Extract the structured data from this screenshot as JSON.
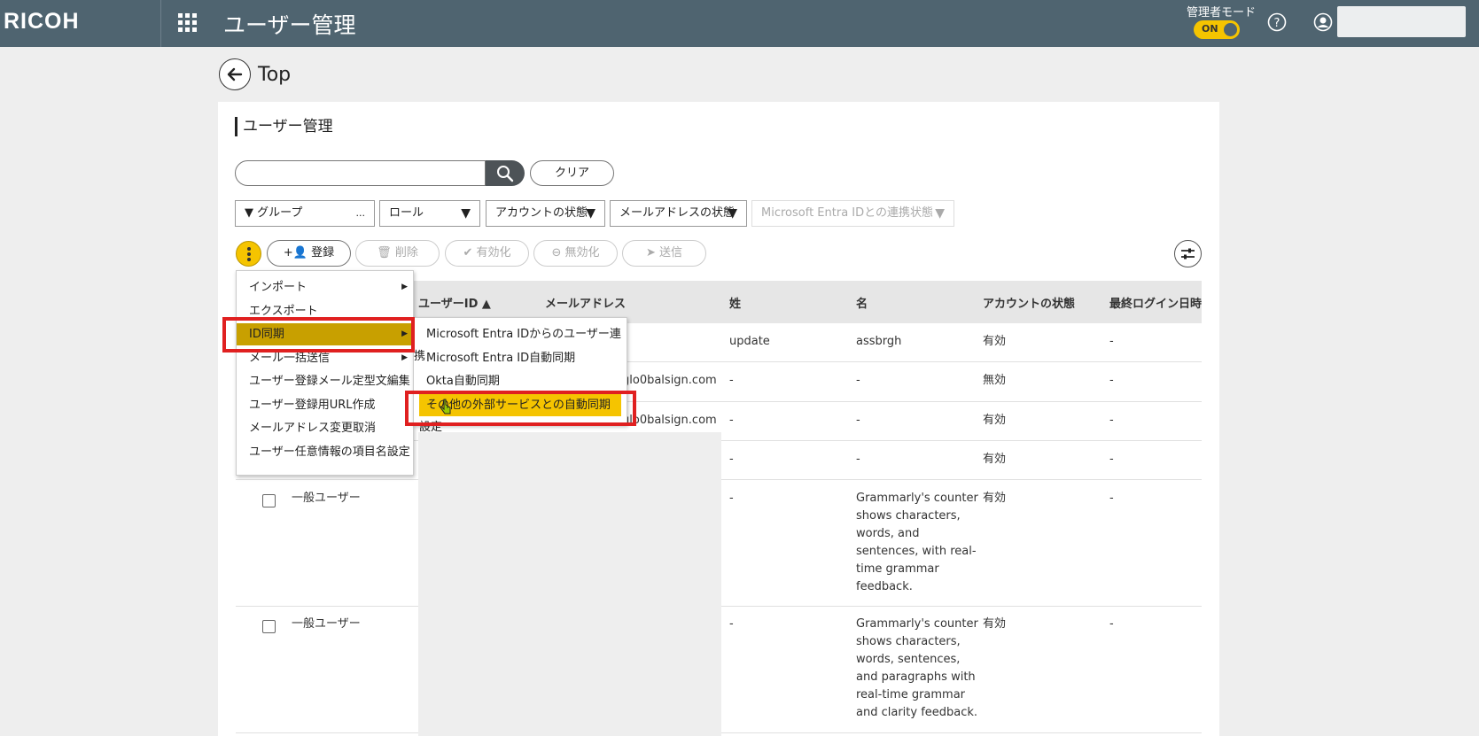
{
  "header": {
    "logo": "RICOH",
    "title": "ユーザー管理",
    "admin_mode_label": "管理者モード",
    "admin_mode_toggle": "ON"
  },
  "nav": {
    "back_label": "Top"
  },
  "page": {
    "title": "ユーザー管理",
    "search_placeholder": "",
    "clear_label": "クリア"
  },
  "filters": {
    "group": "グループ",
    "group_more": "...",
    "role": "ロール",
    "account_state": "アカウントの状態",
    "email_state": "メールアドレスの状態",
    "entra_link_state": "Microsoft Entra IDとの連携状態"
  },
  "actions": {
    "register": "登録",
    "delete": "削除",
    "enable": "有効化",
    "disable": "無効化",
    "send": "送信"
  },
  "table": {
    "headers": {
      "user_id": "ユーザーID ▲",
      "email": "メールアドレス",
      "last_name": "姓",
      "first_name": "名",
      "account_state": "アカウントの状態",
      "last_login": "最終ログイン日時"
    },
    "rows": [
      {
        "last_name": "update",
        "first_name": "assbrgh",
        "state": "有効",
        "last_login": "-"
      },
      {
        "email_tail": "glo0balsign.com",
        "last_name": "-",
        "first_name": "-",
        "state": "無効",
        "last_login": "-"
      },
      {
        "email_tail": "glo0balsign.com",
        "last_name": "-",
        "first_name": "-",
        "state": "有効",
        "last_login": "-"
      },
      {
        "last_name": "-",
        "first_name": "-",
        "state": "有効",
        "last_login": "-"
      },
      {
        "role": "一般ユーザー",
        "last_name": "-",
        "first_name_lines": [
          "Grammarly's counter",
          "shows characters,",
          "words, and",
          "sentences, with real-",
          "time grammar",
          "feedback."
        ],
        "state": "有効",
        "last_login": "-"
      },
      {
        "role": "一般ユーザー",
        "last_name": "-",
        "first_name_lines": [
          "Grammarly's counter",
          "shows characters,",
          "words, sentences,",
          "and paragraphs with",
          "real-time grammar",
          "and clarity feedback."
        ],
        "state": "有効",
        "last_login": "-"
      }
    ]
  },
  "menu": {
    "items": [
      "インポート",
      "エクスポート",
      "ID同期",
      "メール一括送信",
      "ユーザー登録メール定型文編集",
      "ユーザー登録用URL作成",
      "メールアドレス変更取消",
      "ユーザー任意情報の項目名設定"
    ],
    "active": "ID同期"
  },
  "submenu": {
    "items": [
      "Microsoft Entra IDからのユーザー連携",
      "Microsoft Entra ID自動同期",
      "Okta自動同期",
      "その他の外部サービスとの自動同期設定"
    ],
    "active": "その他の外部サービスとの自動同期設定"
  },
  "colors": {
    "header_bg": "#4f6470",
    "accent": "#f5c400",
    "highlight": "#c8a000",
    "annotation": "#e02020"
  }
}
